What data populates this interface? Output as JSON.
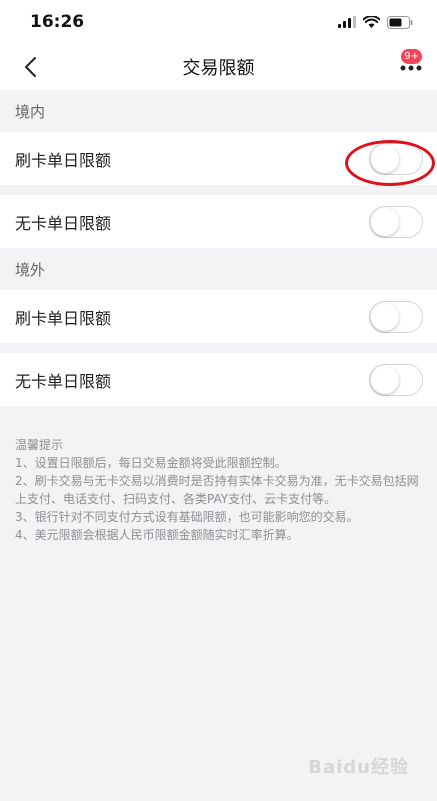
{
  "status_bar": {
    "time": "16:26"
  },
  "nav": {
    "title": "交易限额",
    "badge": "9+"
  },
  "sections": [
    {
      "header": "境内",
      "rows": [
        {
          "label": "刷卡单日限额",
          "enabled": false
        },
        {
          "label": "无卡单日限额",
          "enabled": false
        }
      ]
    },
    {
      "header": "境外",
      "rows": [
        {
          "label": "刷卡单日限额",
          "enabled": false
        },
        {
          "label": "无卡单日限额",
          "enabled": false
        }
      ]
    }
  ],
  "tips": {
    "title": "温馨提示",
    "lines": [
      "1、设置日限额后，每日交易金额将受此限额控制。",
      "2、刷卡交易与无卡交易以消费时是否持有实体卡交易为准，无卡交易包括网上支付、电话支付、扫码支付、各类PAY支付、云卡支付等。",
      "3、银行针对不同支付方式设有基础限额，也可能影响您的交易。",
      "4、美元限额会根据人民币限额金额随实时汇率折算。"
    ]
  },
  "watermark": "Baidu经验",
  "colors": {
    "highlight": "#e0101a",
    "badge": "#f0455a",
    "background": "#f3f3f5"
  }
}
